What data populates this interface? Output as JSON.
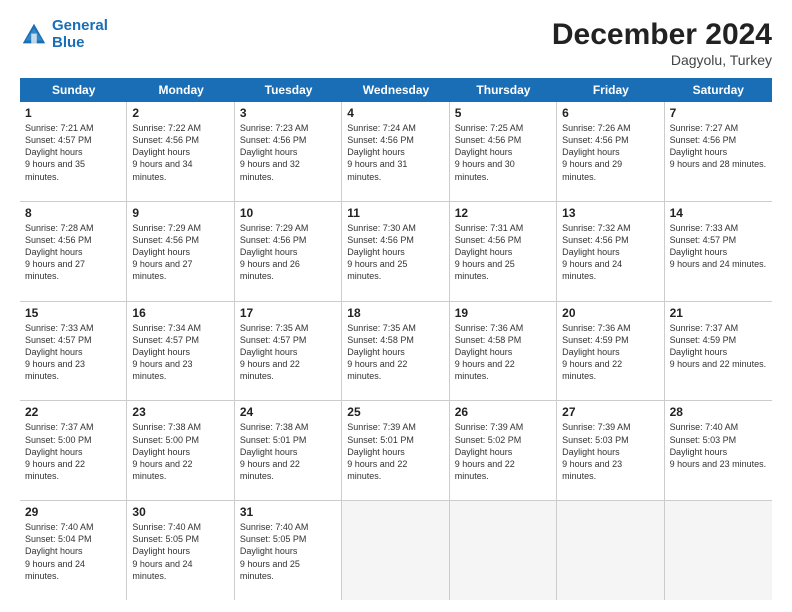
{
  "header": {
    "logo_line1": "General",
    "logo_line2": "Blue",
    "month": "December 2024",
    "location": "Dagyolu, Turkey"
  },
  "days_of_week": [
    "Sunday",
    "Monday",
    "Tuesday",
    "Wednesday",
    "Thursday",
    "Friday",
    "Saturday"
  ],
  "weeks": [
    [
      {
        "day": "1",
        "sunrise": "7:21 AM",
        "sunset": "4:57 PM",
        "daylight": "9 hours and 35 minutes."
      },
      {
        "day": "2",
        "sunrise": "7:22 AM",
        "sunset": "4:56 PM",
        "daylight": "9 hours and 34 minutes."
      },
      {
        "day": "3",
        "sunrise": "7:23 AM",
        "sunset": "4:56 PM",
        "daylight": "9 hours and 32 minutes."
      },
      {
        "day": "4",
        "sunrise": "7:24 AM",
        "sunset": "4:56 PM",
        "daylight": "9 hours and 31 minutes."
      },
      {
        "day": "5",
        "sunrise": "7:25 AM",
        "sunset": "4:56 PM",
        "daylight": "9 hours and 30 minutes."
      },
      {
        "day": "6",
        "sunrise": "7:26 AM",
        "sunset": "4:56 PM",
        "daylight": "9 hours and 29 minutes."
      },
      {
        "day": "7",
        "sunrise": "7:27 AM",
        "sunset": "4:56 PM",
        "daylight": "9 hours and 28 minutes."
      }
    ],
    [
      {
        "day": "8",
        "sunrise": "7:28 AM",
        "sunset": "4:56 PM",
        "daylight": "9 hours and 27 minutes."
      },
      {
        "day": "9",
        "sunrise": "7:29 AM",
        "sunset": "4:56 PM",
        "daylight": "9 hours and 27 minutes."
      },
      {
        "day": "10",
        "sunrise": "7:29 AM",
        "sunset": "4:56 PM",
        "daylight": "9 hours and 26 minutes."
      },
      {
        "day": "11",
        "sunrise": "7:30 AM",
        "sunset": "4:56 PM",
        "daylight": "9 hours and 25 minutes."
      },
      {
        "day": "12",
        "sunrise": "7:31 AM",
        "sunset": "4:56 PM",
        "daylight": "9 hours and 25 minutes."
      },
      {
        "day": "13",
        "sunrise": "7:32 AM",
        "sunset": "4:56 PM",
        "daylight": "9 hours and 24 minutes."
      },
      {
        "day": "14",
        "sunrise": "7:33 AM",
        "sunset": "4:57 PM",
        "daylight": "9 hours and 24 minutes."
      }
    ],
    [
      {
        "day": "15",
        "sunrise": "7:33 AM",
        "sunset": "4:57 PM",
        "daylight": "9 hours and 23 minutes."
      },
      {
        "day": "16",
        "sunrise": "7:34 AM",
        "sunset": "4:57 PM",
        "daylight": "9 hours and 23 minutes."
      },
      {
        "day": "17",
        "sunrise": "7:35 AM",
        "sunset": "4:57 PM",
        "daylight": "9 hours and 22 minutes."
      },
      {
        "day": "18",
        "sunrise": "7:35 AM",
        "sunset": "4:58 PM",
        "daylight": "9 hours and 22 minutes."
      },
      {
        "day": "19",
        "sunrise": "7:36 AM",
        "sunset": "4:58 PM",
        "daylight": "9 hours and 22 minutes."
      },
      {
        "day": "20",
        "sunrise": "7:36 AM",
        "sunset": "4:59 PM",
        "daylight": "9 hours and 22 minutes."
      },
      {
        "day": "21",
        "sunrise": "7:37 AM",
        "sunset": "4:59 PM",
        "daylight": "9 hours and 22 minutes."
      }
    ],
    [
      {
        "day": "22",
        "sunrise": "7:37 AM",
        "sunset": "5:00 PM",
        "daylight": "9 hours and 22 minutes."
      },
      {
        "day": "23",
        "sunrise": "7:38 AM",
        "sunset": "5:00 PM",
        "daylight": "9 hours and 22 minutes."
      },
      {
        "day": "24",
        "sunrise": "7:38 AM",
        "sunset": "5:01 PM",
        "daylight": "9 hours and 22 minutes."
      },
      {
        "day": "25",
        "sunrise": "7:39 AM",
        "sunset": "5:01 PM",
        "daylight": "9 hours and 22 minutes."
      },
      {
        "day": "26",
        "sunrise": "7:39 AM",
        "sunset": "5:02 PM",
        "daylight": "9 hours and 22 minutes."
      },
      {
        "day": "27",
        "sunrise": "7:39 AM",
        "sunset": "5:03 PM",
        "daylight": "9 hours and 23 minutes."
      },
      {
        "day": "28",
        "sunrise": "7:40 AM",
        "sunset": "5:03 PM",
        "daylight": "9 hours and 23 minutes."
      }
    ],
    [
      {
        "day": "29",
        "sunrise": "7:40 AM",
        "sunset": "5:04 PM",
        "daylight": "9 hours and 24 minutes."
      },
      {
        "day": "30",
        "sunrise": "7:40 AM",
        "sunset": "5:05 PM",
        "daylight": "9 hours and 24 minutes."
      },
      {
        "day": "31",
        "sunrise": "7:40 AM",
        "sunset": "5:05 PM",
        "daylight": "9 hours and 25 minutes."
      },
      null,
      null,
      null,
      null
    ]
  ]
}
